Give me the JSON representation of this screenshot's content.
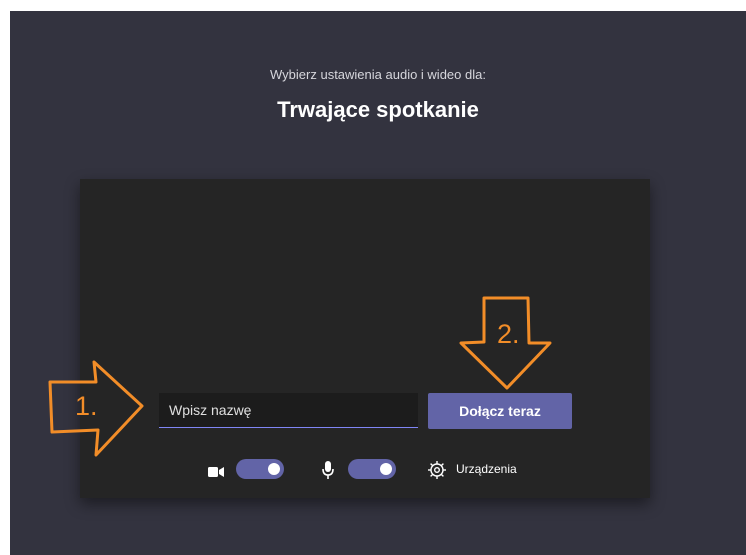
{
  "header": {
    "subtitle": "Wybierz ustawienia audio i wideo dla:",
    "title": "Trwające spotkanie"
  },
  "prejoin": {
    "name_placeholder": "Wpisz nazwę",
    "name_value": "",
    "join_label": "Dołącz teraz"
  },
  "controls": {
    "camera": {
      "icon": "video-camera-icon",
      "on": true
    },
    "microphone": {
      "icon": "microphone-icon",
      "on": true
    },
    "devices": {
      "icon": "gear-icon",
      "label": "Urządzenia"
    }
  },
  "annotations": [
    {
      "label": "1.",
      "icon": "arrow-right-icon"
    },
    {
      "label": "2.",
      "icon": "arrow-down-icon"
    }
  ],
  "colors": {
    "background": "#33333f",
    "panel": "#252525",
    "accent": "#6264a7",
    "annotation": "#f28d28"
  }
}
